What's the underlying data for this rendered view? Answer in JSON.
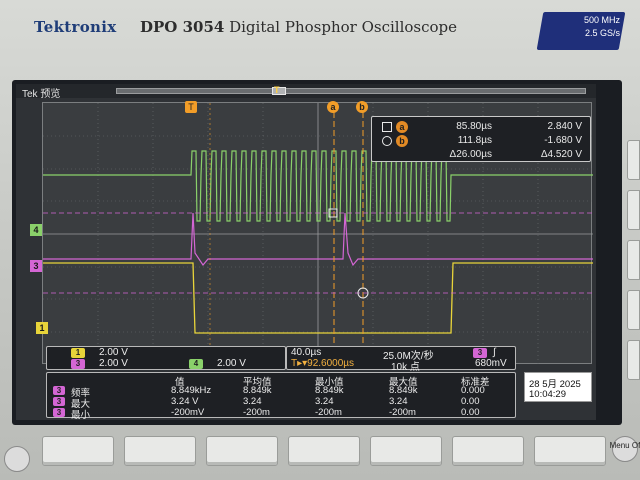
{
  "device": {
    "brand": "Tektronix",
    "model_number": "DPO 3054",
    "model_name": "Digital Phosphor Oscilloscope",
    "bandwidth": "500 MHz",
    "sample_rate": "2.5 GS/s"
  },
  "screen": {
    "tek_label": "Tek 预览",
    "record_marker": "T"
  },
  "markers": {
    "trigger": "T",
    "cursor_a": "a",
    "cursor_b": "b",
    "ch4": "4",
    "ch3": "3",
    "ch1": "1"
  },
  "cursors": {
    "row_a_time": "85.80µs",
    "row_a_volt": "2.840 V",
    "row_b_time": "111.8µs",
    "row_b_volt": "-1.680 V",
    "delta_time": "Δ26.00µs",
    "delta_volt": "Δ4.520 V",
    "tag_a": "a",
    "tag_b": "b"
  },
  "channels": {
    "ch1_badge": "1",
    "ch1_scale": "2.00 V",
    "ch3_badge": "3",
    "ch3_scale": "2.00 V",
    "ch4_badge": "4",
    "ch4_scale": "2.00 V"
  },
  "timebase": {
    "horizontal_scale": "40.0µs",
    "trigger_position": "T▸▾92.6000µs",
    "sample_rate": "25.0M次/秒",
    "record_length": "10k 点",
    "trigger_source_badge": "3",
    "trigger_slope": "∫",
    "trigger_level": "680mV"
  },
  "measurements": {
    "headers": [
      "值",
      "平均值",
      "最小值",
      "最大值",
      "标准差"
    ],
    "rows": [
      {
        "badge": "3",
        "label": "频率",
        "value": "8.849kHz",
        "mean": "8.849k",
        "min": "8.849k",
        "max": "8.849k",
        "std": "0.000"
      },
      {
        "badge": "3",
        "label": "最大",
        "value": "3.24 V",
        "mean": "3.24",
        "min": "3.24",
        "max": "3.24",
        "std": "0.00"
      },
      {
        "badge": "3",
        "label": "最小",
        "value": "-200mV",
        "mean": "-200m",
        "min": "-200m",
        "max": "-200m",
        "std": "0.00"
      }
    ]
  },
  "datetime": {
    "date": "28 5月   2025",
    "time": "10:04:29"
  },
  "front_panel": {
    "menu_button_label": "Menu Off"
  },
  "colors": {
    "ch1_yellow": "#e8d43a",
    "ch3_magenta": "#d466d4",
    "ch4_green": "#8ad16a",
    "cursor_orange": "#f29d28",
    "screen_bg": "#2f3236"
  }
}
